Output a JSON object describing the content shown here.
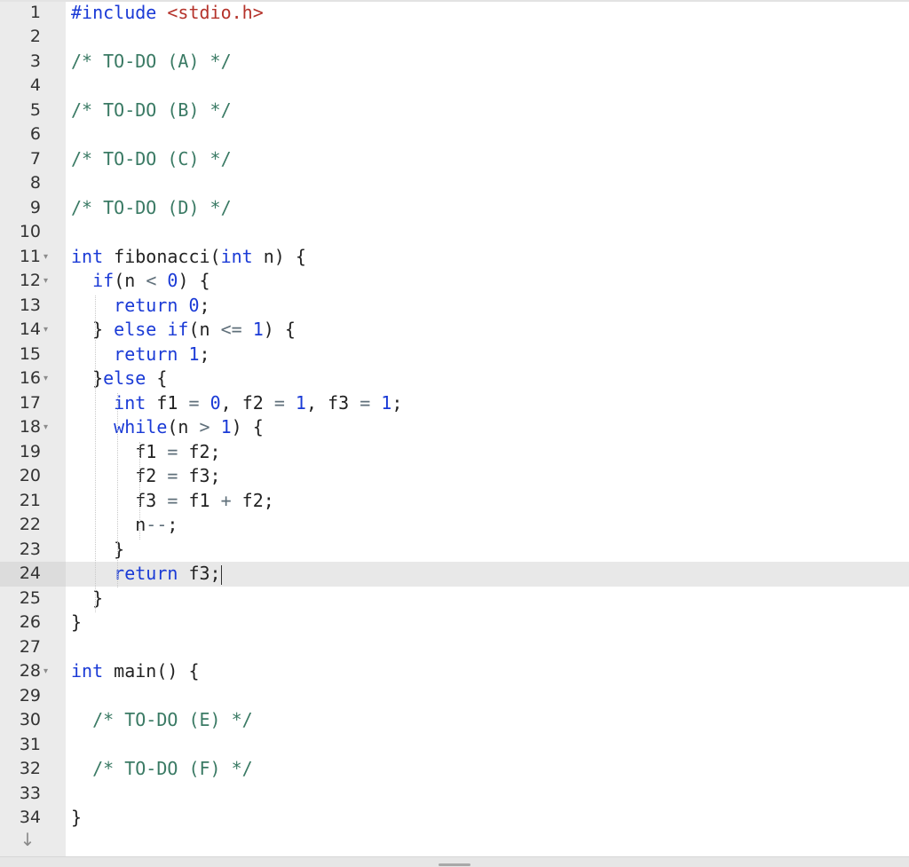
{
  "editor": {
    "active_line": 24,
    "lines": [
      {
        "n": "1",
        "fold": false,
        "tokens": [
          [
            "pp",
            "#include "
          ],
          [
            "str",
            "<stdio.h>"
          ]
        ]
      },
      {
        "n": "2",
        "fold": false,
        "tokens": []
      },
      {
        "n": "3",
        "fold": false,
        "tokens": [
          [
            "cm",
            "/* TO-DO (A) */"
          ]
        ]
      },
      {
        "n": "4",
        "fold": false,
        "tokens": []
      },
      {
        "n": "5",
        "fold": false,
        "tokens": [
          [
            "cm",
            "/* TO-DO (B) */"
          ]
        ]
      },
      {
        "n": "6",
        "fold": false,
        "tokens": []
      },
      {
        "n": "7",
        "fold": false,
        "tokens": [
          [
            "cm",
            "/* TO-DO (C) */"
          ]
        ]
      },
      {
        "n": "8",
        "fold": false,
        "tokens": []
      },
      {
        "n": "9",
        "fold": false,
        "tokens": [
          [
            "cm",
            "/* TO-DO (D) */"
          ]
        ]
      },
      {
        "n": "10",
        "fold": false,
        "tokens": []
      },
      {
        "n": "11",
        "fold": true,
        "tokens": [
          [
            "kw",
            "int"
          ],
          [
            "tx",
            " fibonacci("
          ],
          [
            "kw",
            "int"
          ],
          [
            "tx",
            " n) {"
          ]
        ]
      },
      {
        "n": "12",
        "fold": true,
        "tokens": [
          [
            "tx",
            "  "
          ],
          [
            "kw",
            "if"
          ],
          [
            "tx",
            "(n "
          ],
          [
            "op",
            "<"
          ],
          [
            "tx",
            " "
          ],
          [
            "num",
            "0"
          ],
          [
            "tx",
            ") {"
          ]
        ]
      },
      {
        "n": "13",
        "fold": false,
        "tokens": [
          [
            "tx",
            "    "
          ],
          [
            "kw",
            "return"
          ],
          [
            "tx",
            " "
          ],
          [
            "num",
            "0"
          ],
          [
            "tx",
            ";"
          ]
        ]
      },
      {
        "n": "14",
        "fold": true,
        "tokens": [
          [
            "tx",
            "  } "
          ],
          [
            "kw",
            "else"
          ],
          [
            "tx",
            " "
          ],
          [
            "kw",
            "if"
          ],
          [
            "tx",
            "(n "
          ],
          [
            "op",
            "<="
          ],
          [
            "tx",
            " "
          ],
          [
            "num",
            "1"
          ],
          [
            "tx",
            ") {"
          ]
        ]
      },
      {
        "n": "15",
        "fold": false,
        "tokens": [
          [
            "tx",
            "    "
          ],
          [
            "kw",
            "return"
          ],
          [
            "tx",
            " "
          ],
          [
            "num",
            "1"
          ],
          [
            "tx",
            ";"
          ]
        ]
      },
      {
        "n": "16",
        "fold": true,
        "tokens": [
          [
            "tx",
            "  }"
          ],
          [
            "kw",
            "else"
          ],
          [
            "tx",
            " {"
          ]
        ]
      },
      {
        "n": "17",
        "fold": false,
        "tokens": [
          [
            "tx",
            "    "
          ],
          [
            "kw",
            "int"
          ],
          [
            "tx",
            " f1 "
          ],
          [
            "op",
            "="
          ],
          [
            "tx",
            " "
          ],
          [
            "num",
            "0"
          ],
          [
            "tx",
            ", f2 "
          ],
          [
            "op",
            "="
          ],
          [
            "tx",
            " "
          ],
          [
            "num",
            "1"
          ],
          [
            "tx",
            ", f3 "
          ],
          [
            "op",
            "="
          ],
          [
            "tx",
            " "
          ],
          [
            "num",
            "1"
          ],
          [
            "tx",
            ";"
          ]
        ]
      },
      {
        "n": "18",
        "fold": true,
        "tokens": [
          [
            "tx",
            "    "
          ],
          [
            "kw",
            "while"
          ],
          [
            "tx",
            "(n "
          ],
          [
            "op",
            ">"
          ],
          [
            "tx",
            " "
          ],
          [
            "num",
            "1"
          ],
          [
            "tx",
            ") {"
          ]
        ]
      },
      {
        "n": "19",
        "fold": false,
        "tokens": [
          [
            "tx",
            "      f1 "
          ],
          [
            "op",
            "="
          ],
          [
            "tx",
            " f2;"
          ]
        ]
      },
      {
        "n": "20",
        "fold": false,
        "tokens": [
          [
            "tx",
            "      f2 "
          ],
          [
            "op",
            "="
          ],
          [
            "tx",
            " f3;"
          ]
        ]
      },
      {
        "n": "21",
        "fold": false,
        "tokens": [
          [
            "tx",
            "      f3 "
          ],
          [
            "op",
            "="
          ],
          [
            "tx",
            " f1 "
          ],
          [
            "op",
            "+"
          ],
          [
            "tx",
            " f2;"
          ]
        ]
      },
      {
        "n": "22",
        "fold": false,
        "tokens": [
          [
            "tx",
            "      n"
          ],
          [
            "op",
            "--"
          ],
          [
            "tx",
            ";"
          ]
        ]
      },
      {
        "n": "23",
        "fold": false,
        "tokens": [
          [
            "tx",
            "    }"
          ]
        ]
      },
      {
        "n": "24",
        "fold": false,
        "tokens": [
          [
            "tx",
            "    "
          ],
          [
            "kw",
            "return"
          ],
          [
            "tx",
            " f3;"
          ]
        ]
      },
      {
        "n": "25",
        "fold": false,
        "tokens": [
          [
            "tx",
            "  }"
          ]
        ]
      },
      {
        "n": "26",
        "fold": false,
        "tokens": [
          [
            "tx",
            "}"
          ]
        ]
      },
      {
        "n": "27",
        "fold": false,
        "tokens": []
      },
      {
        "n": "28",
        "fold": true,
        "tokens": [
          [
            "kw",
            "int"
          ],
          [
            "tx",
            " main() {"
          ]
        ]
      },
      {
        "n": "29",
        "fold": false,
        "tokens": []
      },
      {
        "n": "30",
        "fold": false,
        "tokens": [
          [
            "tx",
            "  "
          ],
          [
            "cm",
            "/* TO-DO (E) */"
          ]
        ]
      },
      {
        "n": "31",
        "fold": false,
        "tokens": []
      },
      {
        "n": "32",
        "fold": false,
        "tokens": [
          [
            "tx",
            "  "
          ],
          [
            "cm",
            "/* TO-DO (F) */"
          ]
        ]
      },
      {
        "n": "33",
        "fold": false,
        "tokens": []
      },
      {
        "n": "34",
        "fold": false,
        "tokens": [
          [
            "tx",
            "}"
          ]
        ]
      }
    ]
  },
  "icons": {
    "fold_arrow": "▾",
    "scroll_down": "↓"
  }
}
